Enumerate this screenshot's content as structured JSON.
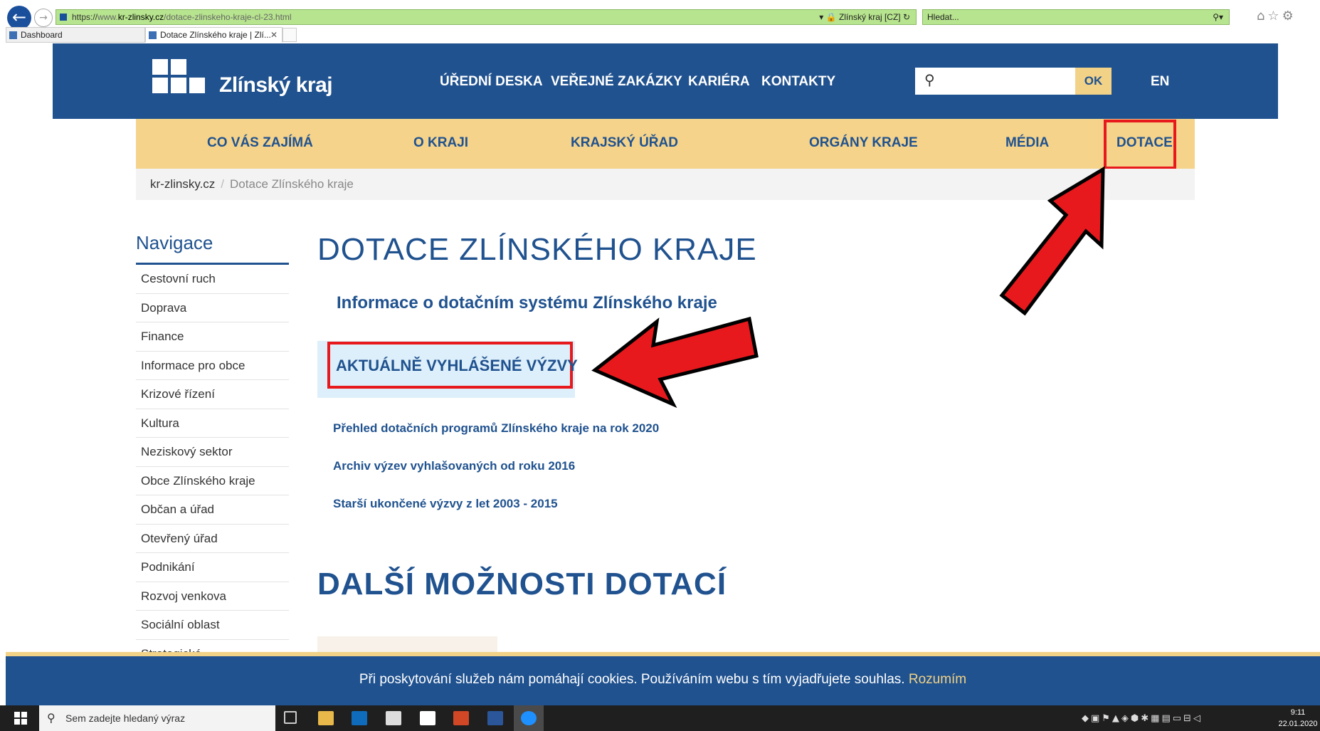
{
  "browser": {
    "url_scheme": "https://",
    "url_host_prefix": "www.",
    "url_host": "kr-zlinsky.cz",
    "url_path": "/dotace-zlinskeho-kraje-cl-23.html",
    "security_label": "Zlínský kraj [CZ]",
    "search_placeholder": "Hledat...",
    "tabs": [
      {
        "label": "Dashboard"
      },
      {
        "label": "Dotace Zlínského kraje | Zlí..."
      }
    ]
  },
  "header": {
    "logo_text": "Zlínský kraj",
    "top_links": [
      "ÚŘEDNÍ DESKA",
      "VEŘEJNÉ ZAKÁZKY",
      "KARIÉRA",
      "KONTAKTY"
    ],
    "search_button": "OK",
    "lang_link": "EN"
  },
  "main_nav": [
    "CO VÁS ZAJÍMÁ",
    "O KRAJI",
    "KRAJSKÝ ÚŘAD",
    "ORGÁNY KRAJE",
    "MÉDIA",
    "DOTACE"
  ],
  "breadcrumb": {
    "home": "kr-zlinsky.cz",
    "separator": "/",
    "current": "Dotace Zlínského kraje"
  },
  "sidebar": {
    "title": "Navigace",
    "items": [
      "Cestovní ruch",
      "Doprava",
      "Finance",
      "Informace pro obce",
      "Krizové řízení",
      "Kultura",
      "Neziskový sektor",
      "Obce Zlínského kraje",
      "Občan a úřad",
      "Otevřený úřad",
      "Podnikání",
      "Rozvoj venkova",
      "Sociální oblast",
      "Strategické"
    ]
  },
  "content": {
    "heading": "DOTACE ZLÍNSKÉHO KRAJE",
    "info_link": "Informace o dotačním systému Zlínského kraje",
    "highlight_link": "AKTUÁLNĚ VYHLÁŠENÉ VÝZVY",
    "links": [
      "Přehled dotačních programů Zlínského kraje na rok 2020",
      "Archiv výzev vyhlašovaných od roku 2016",
      "Starší ukončené výzvy z let 2003 - 2015"
    ],
    "heading2": "DALŠÍ MOŽNOSTI DOTACÍ"
  },
  "cookie": {
    "text": "Při poskytování služeb nám pomáhají cookies. Používáním webu s tím vyjadřujete souhlas.",
    "accept": "Rozumím"
  },
  "taskbar": {
    "search_placeholder": "Sem zadejte hledaný výraz",
    "time": "9:11",
    "date": "22.01.2020"
  },
  "colors": {
    "brand_blue": "#20528f",
    "nav_yellow": "#f5d38a",
    "highlight_red": "#e8191d"
  }
}
